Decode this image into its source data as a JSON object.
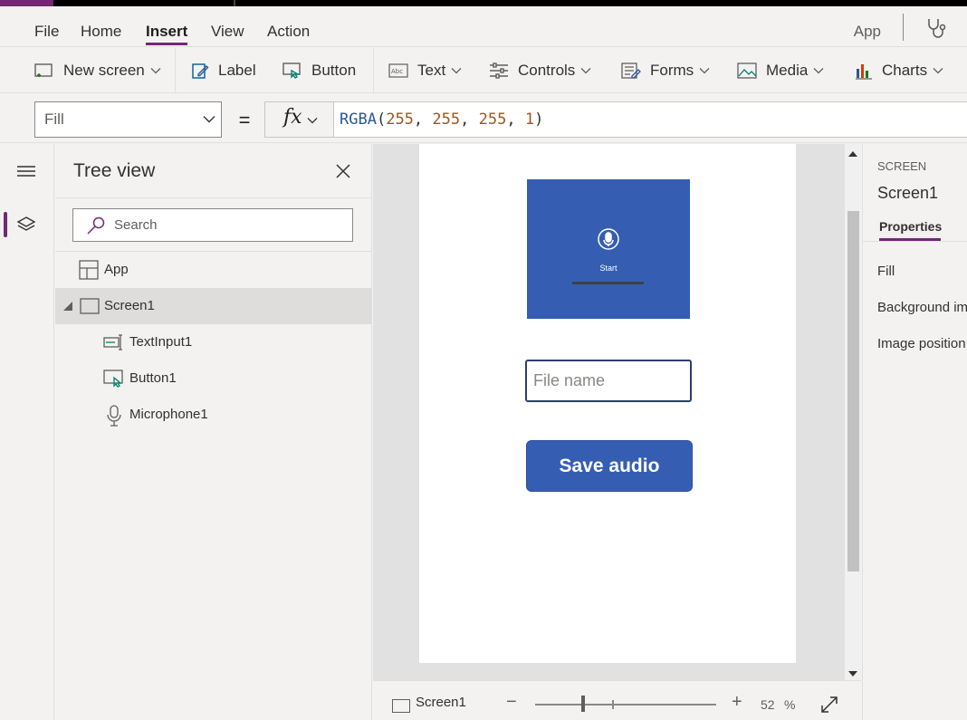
{
  "menubar": {
    "items": [
      {
        "label": "File",
        "active": false
      },
      {
        "label": "Home",
        "active": false
      },
      {
        "label": "Insert",
        "active": true
      },
      {
        "label": "View",
        "active": false
      },
      {
        "label": "Action",
        "active": false
      }
    ],
    "right_label": "App",
    "right_icon": "stethoscope-icon"
  },
  "ribbon": {
    "new_screen": "New screen",
    "label": "Label",
    "button": "Button",
    "text": "Text",
    "controls": "Controls",
    "forms": "Forms",
    "media": "Media",
    "charts": "Charts"
  },
  "formula": {
    "property": "Fill",
    "equals": "=",
    "fx": "fx",
    "fn": "RGBA",
    "open": "(",
    "a": "255",
    "comma1": ", ",
    "b": "255",
    "comma2": ", ",
    "c": "255",
    "comma3": ", ",
    "d": "1",
    "close": ")"
  },
  "treeview": {
    "title": "Tree view",
    "search_placeholder": "Search",
    "items": [
      {
        "label": "App",
        "icon": "app-icon"
      },
      {
        "label": "Screen1",
        "icon": "screen-icon",
        "selected": true
      },
      {
        "label": "TextInput1",
        "icon": "text-input-icon"
      },
      {
        "label": "Button1",
        "icon": "button-icon"
      },
      {
        "label": "Microphone1",
        "icon": "microphone-icon"
      }
    ]
  },
  "canvas": {
    "mic_label": "Start",
    "text_input_placeholder": "File name",
    "save_button": "Save audio",
    "colors": {
      "control_blue": "#355eb3",
      "screen_fill": "#ffffff"
    }
  },
  "statusbar": {
    "screen_name": "Screen1",
    "zoom_minus": "−",
    "zoom_plus": "+",
    "zoom_value": "52",
    "zoom_unit": "%"
  },
  "properties": {
    "type_label": "SCREEN",
    "name": "Screen1",
    "tab": "Properties",
    "items": [
      "Fill",
      "Background im",
      "Image position"
    ]
  },
  "theme": {
    "accent": "#742774"
  }
}
